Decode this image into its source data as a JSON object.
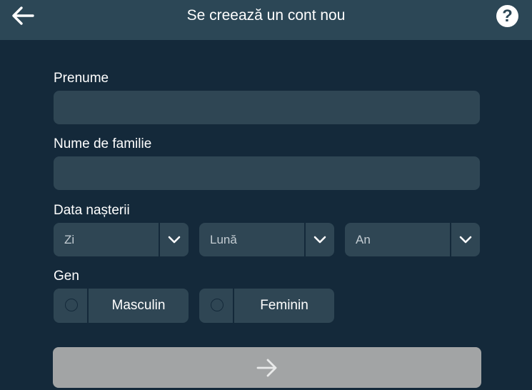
{
  "header": {
    "title": "Se creează un cont nou",
    "back_icon": "arrow-left-icon",
    "help_icon": "question-icon",
    "help_glyph": "?"
  },
  "form": {
    "first_name": {
      "label": "Prenume",
      "value": ""
    },
    "last_name": {
      "label": "Nume de familie",
      "value": ""
    },
    "birth_date": {
      "label": "Data nașterii",
      "day": "Zi",
      "month": "Lună",
      "year": "An"
    },
    "gender": {
      "label": "Gen",
      "options": [
        "Masculin",
        "Feminin"
      ]
    },
    "submit_icon": "arrow-right-icon"
  },
  "colors": {
    "background": "#14293a",
    "header": "#2c4756",
    "field": "#2f4654",
    "submit_disabled": "#a2a4a5"
  }
}
